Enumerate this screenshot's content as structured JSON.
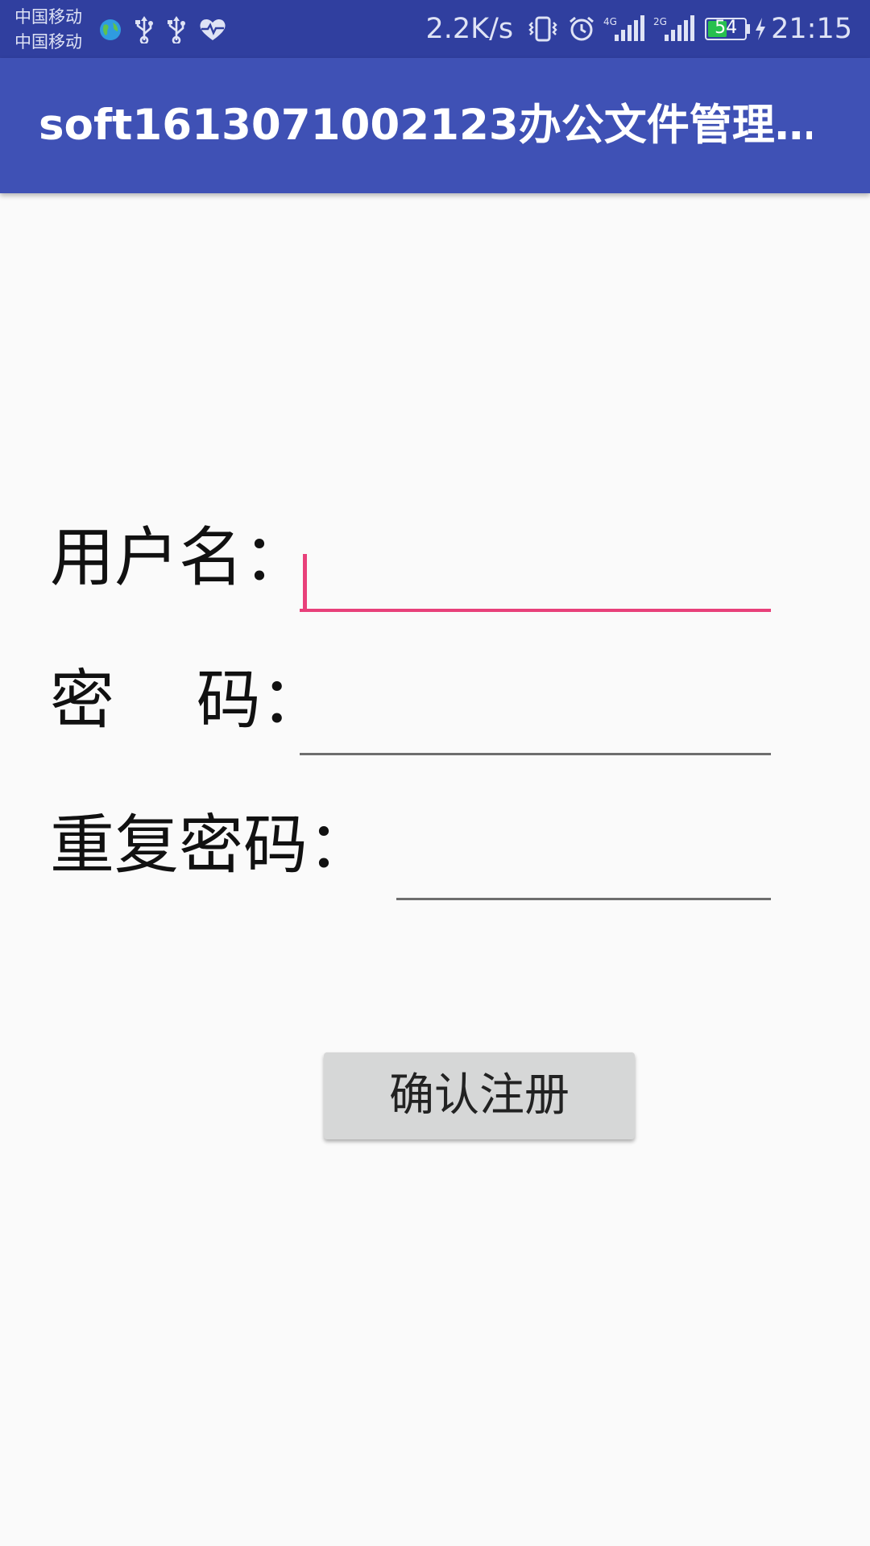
{
  "status_bar": {
    "carrier_1": "中国移动",
    "carrier_2": "中国移动",
    "net_speed": "2.2K/s",
    "network_type_1": "4G",
    "network_type_2": "2G",
    "battery_level": "54",
    "battery_fraction": 0.54,
    "time": "21:15",
    "icons": [
      "globe-icon",
      "usb-icon",
      "usb-icon",
      "heartbeat-icon",
      "vibrate-icon",
      "alarm-icon",
      "signal-icon",
      "signal-icon",
      "battery-icon",
      "charging-icon"
    ],
    "bar_color": "#303f9f"
  },
  "app_bar": {
    "title": "soft1613071002123办公文件管理…",
    "color": "#3f51b5"
  },
  "form": {
    "username_label": "用户名：",
    "username_value": "",
    "password_label": "密    码：",
    "password_value": "",
    "repeat_password_label": "重复密码：",
    "repeat_password_value": "",
    "focus_color": "#e8407a"
  },
  "actions": {
    "confirm_label": "确认注册",
    "button_color": "#d6d7d7"
  }
}
